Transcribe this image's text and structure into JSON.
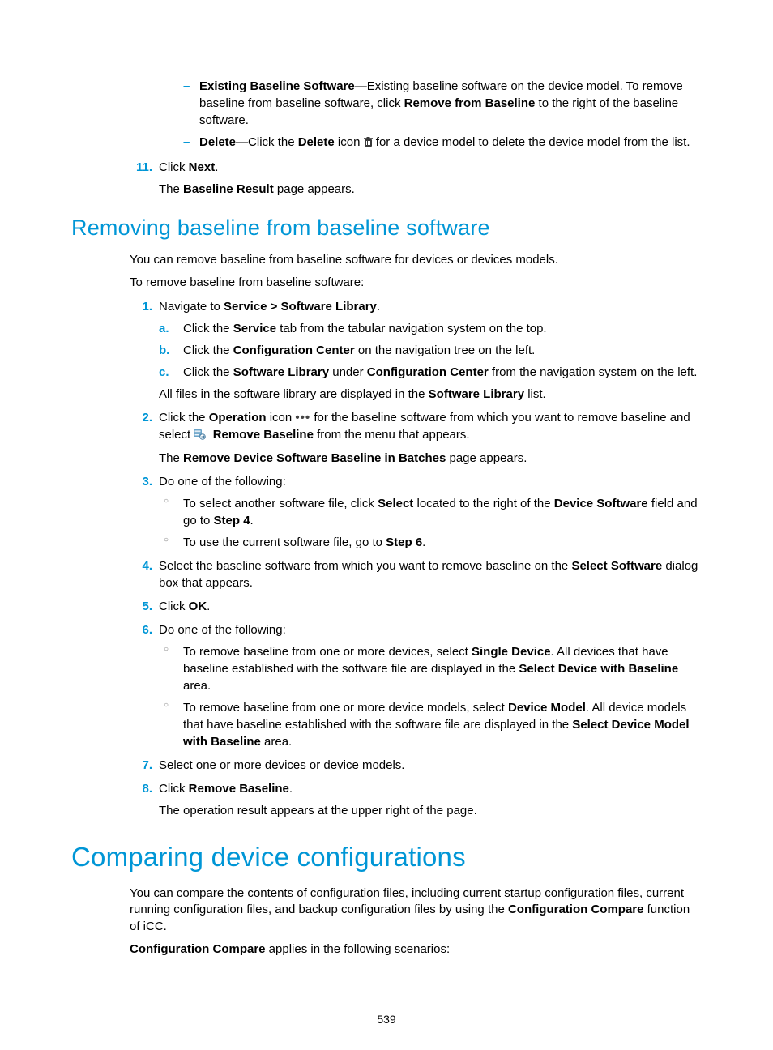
{
  "top": {
    "dash1_pre": "Existing Baseline Software",
    "dash1_rest": "—Existing baseline software on the device model. To remove baseline from baseline software, click ",
    "dash1_bold": "Remove from Baseline",
    "dash1_tail": " to the right of the baseline software.",
    "dash2_pre": "Delete",
    "dash2_mid1": "—Click the ",
    "dash2_bold": "Delete",
    "dash2_mid2": " icon ",
    "dash2_tail": " for a device model to delete the device model from the list.",
    "step11_num": "11.",
    "step11_a": "Click ",
    "step11_b": "Next",
    "step11_c": ".",
    "step11_res_a": "The ",
    "step11_res_b": "Baseline Result",
    "step11_res_c": " page appears."
  },
  "sec1": {
    "title": "Removing baseline from baseline software",
    "intro": "You can remove baseline from baseline software for devices or devices models.",
    "lead": "To remove baseline from baseline software:",
    "s1": {
      "num": "1.",
      "t1": "Navigate to ",
      "t2": "Service > Software Library",
      "t3": ".",
      "a_m": "a.",
      "a1": "Click the ",
      "a2": "Service",
      "a3": " tab from the tabular navigation system on the top.",
      "b_m": "b.",
      "b1": "Click the ",
      "b2": "Configuration Center",
      "b3": " on the navigation tree on the left.",
      "c_m": "c.",
      "c1": "Click the ",
      "c2": "Software Library",
      "c3": " under ",
      "c4": "Configuration Center",
      "c5": " from the navigation system on the left.",
      "post1": "All files in the software library are displayed in the ",
      "post2": "Software Library",
      "post3": " list."
    },
    "s2": {
      "num": "2.",
      "p1": "Click the ",
      "p2": "Operation",
      "p3": " icon ",
      "p4": " for the baseline software from which you want to remove baseline and select ",
      "p5": "Remove Baseline",
      "p6": " from the menu that appears.",
      "r1": "The ",
      "r2": "Remove Device Software Baseline in Batches",
      "r3": " page appears."
    },
    "s3": {
      "num": "3.",
      "lead": "Do one of the following:",
      "o1a": "To select another software file, click ",
      "o1b": "Select",
      "o1c": " located to the right of the ",
      "o1d": "Device Software",
      "o1e": " field and go to ",
      "o1f": "Step 4",
      "o1g": ".",
      "o2a": "To use the current software file, go to ",
      "o2b": "Step 6",
      "o2c": "."
    },
    "s4": {
      "num": "4.",
      "a": "Select the baseline software from which you want to remove baseline on the ",
      "b": "Select Software",
      "c": " dialog box that appears."
    },
    "s5": {
      "num": "5.",
      "a": "Click ",
      "b": "OK",
      "c": "."
    },
    "s6": {
      "num": "6.",
      "lead": "Do one of the following:",
      "o1a": "To remove baseline from one or more devices, select ",
      "o1b": "Single Device",
      "o1c": ". All devices that have baseline established with the software file are displayed in the ",
      "o1d": "Select Device with Baseline",
      "o1e": " area.",
      "o2a": "To remove baseline from one or more device models, select ",
      "o2b": "Device Model",
      "o2c": ". All device models that have baseline established with the software file are displayed in the ",
      "o2d": "Select Device Model with Baseline",
      "o2e": " area."
    },
    "s7": {
      "num": "7.",
      "t": "Select one or more devices or device models."
    },
    "s8": {
      "num": "8.",
      "a": "Click ",
      "b": "Remove Baseline",
      "c": ".",
      "res": "The operation result appears at the upper right of the page."
    }
  },
  "sec2": {
    "title": "Comparing device configurations",
    "p1a": "You can compare the contents of configuration files, including current startup configuration files, current running configuration files, and backup configuration files by using the ",
    "p1b": "Configuration Compare",
    "p1c": " function of iCC.",
    "p2a": "Configuration Compare",
    "p2b": " applies in the following scenarios:"
  },
  "pageno": "539"
}
